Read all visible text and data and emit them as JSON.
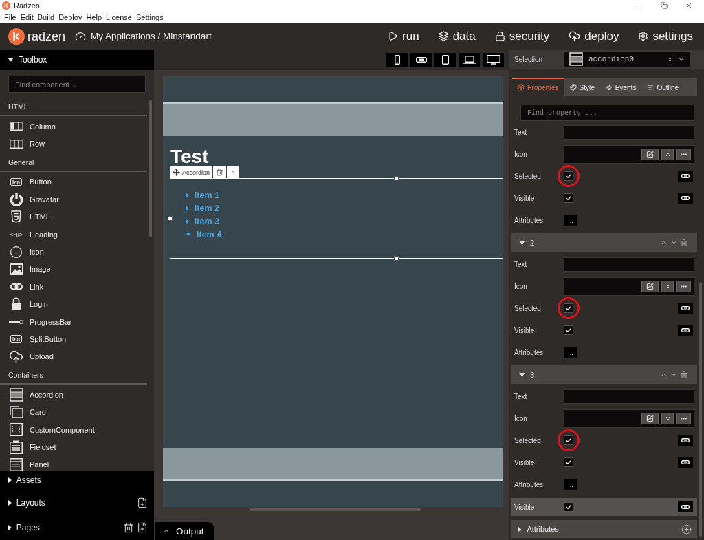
{
  "window": {
    "title": "Radzen"
  },
  "menu": [
    "File",
    "Edit",
    "Build",
    "Deploy",
    "Help",
    "License",
    "Settings"
  ],
  "header": {
    "brand": "radzen",
    "breadcrumb": "My Applications / Minstandart",
    "nav": [
      {
        "kind": "run",
        "label": "run"
      },
      {
        "kind": "data",
        "label": "data"
      },
      {
        "kind": "security",
        "label": "security"
      },
      {
        "kind": "deploy",
        "label": "deploy"
      },
      {
        "kind": "settings",
        "label": "settings"
      }
    ]
  },
  "toolbox": {
    "title": "Toolbox",
    "expanded": true,
    "search": {
      "placeholder": "Find component ..."
    },
    "categories": [
      {
        "name": "HTML",
        "items": [
          {
            "label": "Column",
            "kind": "column"
          },
          {
            "label": "Row",
            "kind": "row"
          }
        ]
      },
      {
        "name": "General",
        "items": [
          {
            "label": "Button",
            "kind": "button",
            "icon_text": "btn"
          },
          {
            "label": "Gravatar",
            "kind": "gravatar"
          },
          {
            "label": "HTML",
            "kind": "html5"
          },
          {
            "label": "Heading",
            "kind": "heading",
            "icon_text": "<H/>"
          },
          {
            "label": "Icon",
            "kind": "icon"
          },
          {
            "label": "Image",
            "kind": "image"
          },
          {
            "label": "Link",
            "kind": "link"
          },
          {
            "label": "Login",
            "kind": "login"
          },
          {
            "label": "ProgressBar",
            "kind": "progressbar"
          },
          {
            "label": "SplitButton",
            "kind": "button",
            "icon_text": "btn"
          },
          {
            "label": "Upload",
            "kind": "upload"
          }
        ]
      },
      {
        "name": "Containers",
        "items": [
          {
            "label": "Accordion",
            "kind": "accordion"
          },
          {
            "label": "Card",
            "kind": "card"
          },
          {
            "label": "CustomComponent",
            "kind": "custom"
          },
          {
            "label": "Fieldset",
            "kind": "fieldset"
          },
          {
            "label": "Panel",
            "kind": "panel"
          }
        ]
      }
    ]
  },
  "panels": [
    {
      "label": "Assets",
      "expanded": false
    },
    {
      "label": "Layouts",
      "expanded": false,
      "actions": [
        {
          "kind": "add"
        }
      ]
    },
    {
      "label": "Pages",
      "expanded": false,
      "actions": [
        {
          "kind": "delete"
        },
        {
          "kind": "add"
        }
      ]
    }
  ],
  "designer": {
    "devices": [
      {
        "kind": "phone"
      },
      {
        "kind": "phone-landscape"
      },
      {
        "kind": "tablet"
      },
      {
        "kind": "laptop"
      },
      {
        "kind": "desktop"
      }
    ],
    "heading": "Test",
    "accordion": {
      "tag": "Accordion",
      "items": [
        {
          "label": "Item 1",
          "expanded": false
        },
        {
          "label": "Item 2",
          "expanded": false
        },
        {
          "label": "Item 3",
          "expanded": false
        },
        {
          "label": "Item 4",
          "expanded": true
        }
      ]
    }
  },
  "output": {
    "label": "Output",
    "expanded": false
  },
  "properties": {
    "selection": {
      "label": "Selection",
      "value": "accordion0"
    },
    "tabs": [
      {
        "label": "Properties",
        "kind": "properties",
        "selected": true
      },
      {
        "label": "Style",
        "kind": "style",
        "selected": false
      },
      {
        "label": "Events",
        "kind": "events",
        "selected": false
      },
      {
        "label": "Outline",
        "kind": "outline",
        "selected": false
      }
    ],
    "search": {
      "placeholder": "Find property ..."
    },
    "groups": [
      {
        "properties": [
          {
            "label": "Text",
            "kind": "text"
          },
          {
            "label": "Icon",
            "kind": "icon"
          },
          {
            "label": "Selected",
            "kind": "checkbox",
            "checked": true,
            "circled": true
          },
          {
            "label": "Visible",
            "kind": "checkbox",
            "checked": true,
            "circled": false
          },
          {
            "label": "Attributes",
            "kind": "attributes",
            "button": "..."
          }
        ]
      },
      {
        "title": "2",
        "expanded": true,
        "properties": [
          {
            "label": "Text",
            "kind": "text"
          },
          {
            "label": "Icon",
            "kind": "icon"
          },
          {
            "label": "Selected",
            "kind": "checkbox",
            "checked": true,
            "circled": true
          },
          {
            "label": "Visible",
            "kind": "checkbox",
            "checked": true,
            "circled": false
          },
          {
            "label": "Attributes",
            "kind": "attributes",
            "button": "..."
          }
        ]
      },
      {
        "title": "3",
        "expanded": true,
        "properties": [
          {
            "label": "Text",
            "kind": "text"
          },
          {
            "label": "Icon",
            "kind": "icon"
          },
          {
            "label": "Selected",
            "kind": "checkbox",
            "checked": true,
            "circled": true
          },
          {
            "label": "Visible",
            "kind": "checkbox",
            "checked": true,
            "circled": false
          },
          {
            "label": "Attributes",
            "kind": "attributes",
            "button": "..."
          }
        ]
      }
    ],
    "rows": [
      {
        "label": "Visible",
        "kind": "checkbox",
        "checked": true,
        "hovered": true
      }
    ],
    "sections": [
      {
        "label": "Attributes",
        "expanded": false
      }
    ]
  }
}
